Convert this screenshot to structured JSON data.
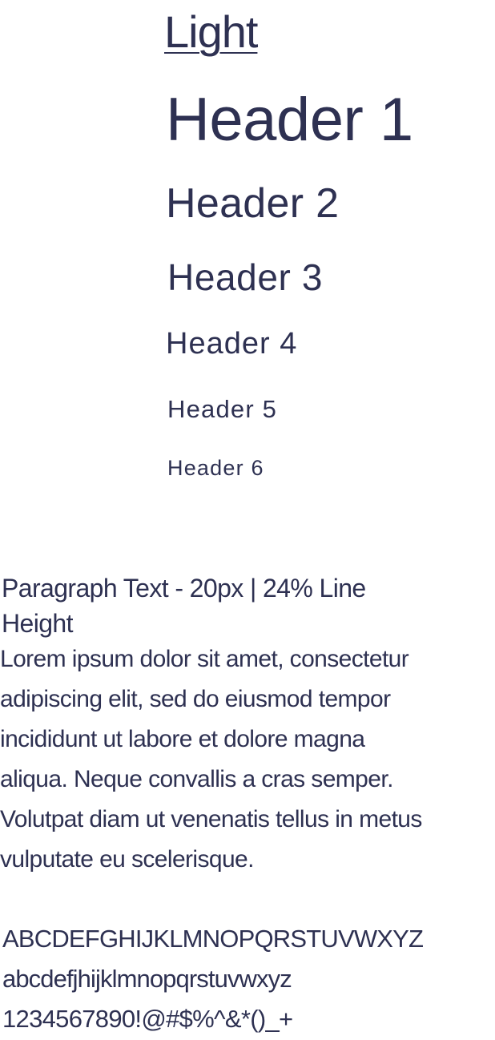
{
  "weight_title": "Light",
  "headers": {
    "h1": "Header 1",
    "h2": "Header 2",
    "h3": "Header 3",
    "h4": "Header 4",
    "h5": "Header 5",
    "h6": "Header 6"
  },
  "paragraph": {
    "label": "Paragraph Text - 20px | 24% Line Height",
    "lines": [
      "Lorem ipsum dolor sit amet, consectetur",
      "adipiscing elit, sed do eiusmod tempor",
      "incididunt ut labore et dolore magna",
      "aliqua. Neque convallis a cras semper.",
      "Volutpat diam ut venenatis tellus in metus",
      "vulputate eu scelerisque."
    ]
  },
  "alphabet": {
    "uppercase": "ABCDEFGHIJKLMNOPQRSTUVWXYZ",
    "lowercase": "abcdefjhijklmnopqrstuvwxyz",
    "numbers_symbols": "1234567890!@#$%^&*()_+"
  },
  "colors": {
    "text": "#2e3152",
    "background": "#ffffff"
  }
}
